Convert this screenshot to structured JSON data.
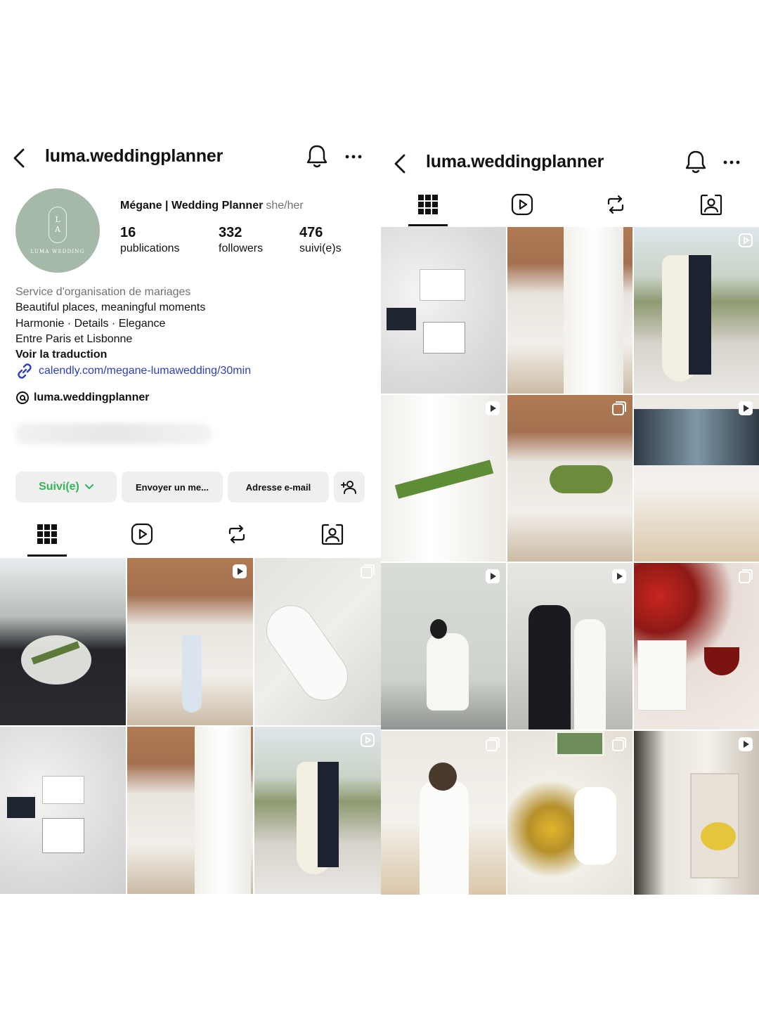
{
  "left": {
    "username": "luma.weddingplanner",
    "avatar_text": "LUMA WEDDING",
    "avatar_monogram": "L\nA",
    "name": "Mégane | Wedding Planner",
    "pronouns": "she/her",
    "stats": [
      {
        "value": "16",
        "label": "publications"
      },
      {
        "value": "332",
        "label": "followers"
      },
      {
        "value": "476",
        "label": "suivi(e)s"
      }
    ],
    "bio": {
      "category": "Service d'organisation de mariages",
      "lines": [
        "Beautiful places, meaningful moments",
        "Harmonie · Details · Elegance",
        "Entre Paris et Lisbonne"
      ],
      "translate": "Voir la traduction",
      "link": "calendly.com/megane-lumawedding/30min"
    },
    "threads": "luma.weddingplanner",
    "buttons": {
      "follow": "Suivi(e)",
      "message": "Envoyer un me...",
      "email": "Adresse e-mail"
    }
  },
  "right": {
    "username": "luma.weddingplanner"
  },
  "icons": {
    "back": "chevron-left-icon",
    "bell": "bell-icon",
    "more": "more-icon",
    "grid": "grid-icon",
    "reels": "reels-icon",
    "reposts": "repost-icon",
    "tagged": "tagged-icon"
  },
  "colors": {
    "follow_text": "#32b45a",
    "link": "#2c3fbf",
    "avatar_bg": "#a5b9a8"
  }
}
